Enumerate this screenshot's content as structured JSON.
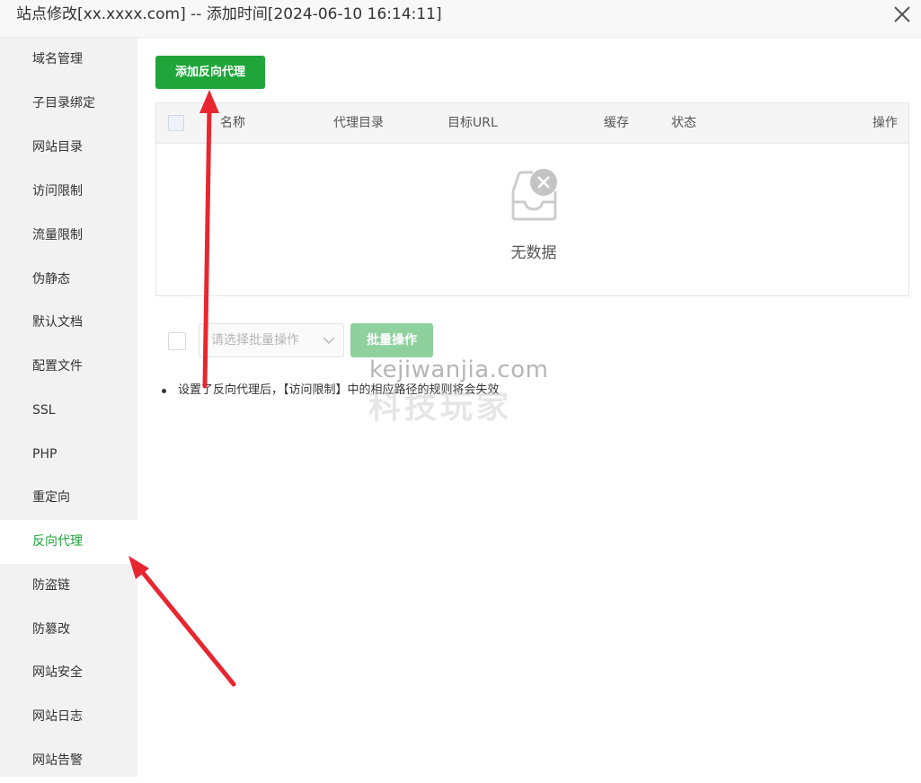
{
  "window": {
    "title": "站点修改[xx.xxxx.com] -- 添加时间[2024-06-10 16:14:11]"
  },
  "sidebar": {
    "items": [
      {
        "label": "域名管理"
      },
      {
        "label": "子目录绑定"
      },
      {
        "label": "网站目录"
      },
      {
        "label": "访问限制"
      },
      {
        "label": "流量限制"
      },
      {
        "label": "伪静态"
      },
      {
        "label": "默认文档"
      },
      {
        "label": "配置文件"
      },
      {
        "label": "SSL"
      },
      {
        "label": "PHP"
      },
      {
        "label": "重定向"
      },
      {
        "label": "反向代理",
        "active": true
      },
      {
        "label": "防盗链"
      },
      {
        "label": "防篡改"
      },
      {
        "label": "网站安全"
      },
      {
        "label": "网站日志"
      },
      {
        "label": "网站告警"
      }
    ]
  },
  "main": {
    "add_button_label": "添加反向代理",
    "table": {
      "columns": [
        "名称",
        "代理目录",
        "目标URL",
        "缓存",
        "状态",
        "操作"
      ],
      "rows": [],
      "empty_text": "无数据"
    },
    "batch": {
      "select_placeholder": "请选择批量操作",
      "button_label": "批量操作"
    },
    "notes": [
      "设置了反向代理后，【访问限制】中的相应路径的规则将会失效"
    ]
  },
  "watermark": {
    "line1": "kejiwanjia.com",
    "line2": "科技玩家"
  },
  "colors": {
    "accent": "#20a53a",
    "accent_disabled": "#8fd19e",
    "annotation_arrow": "#e8262f",
    "sidebar_bg": "#f2f2f2"
  },
  "icons": {
    "close": "close-icon",
    "empty": "empty-inbox-icon",
    "select_chevron": "chevron-down-icon"
  }
}
